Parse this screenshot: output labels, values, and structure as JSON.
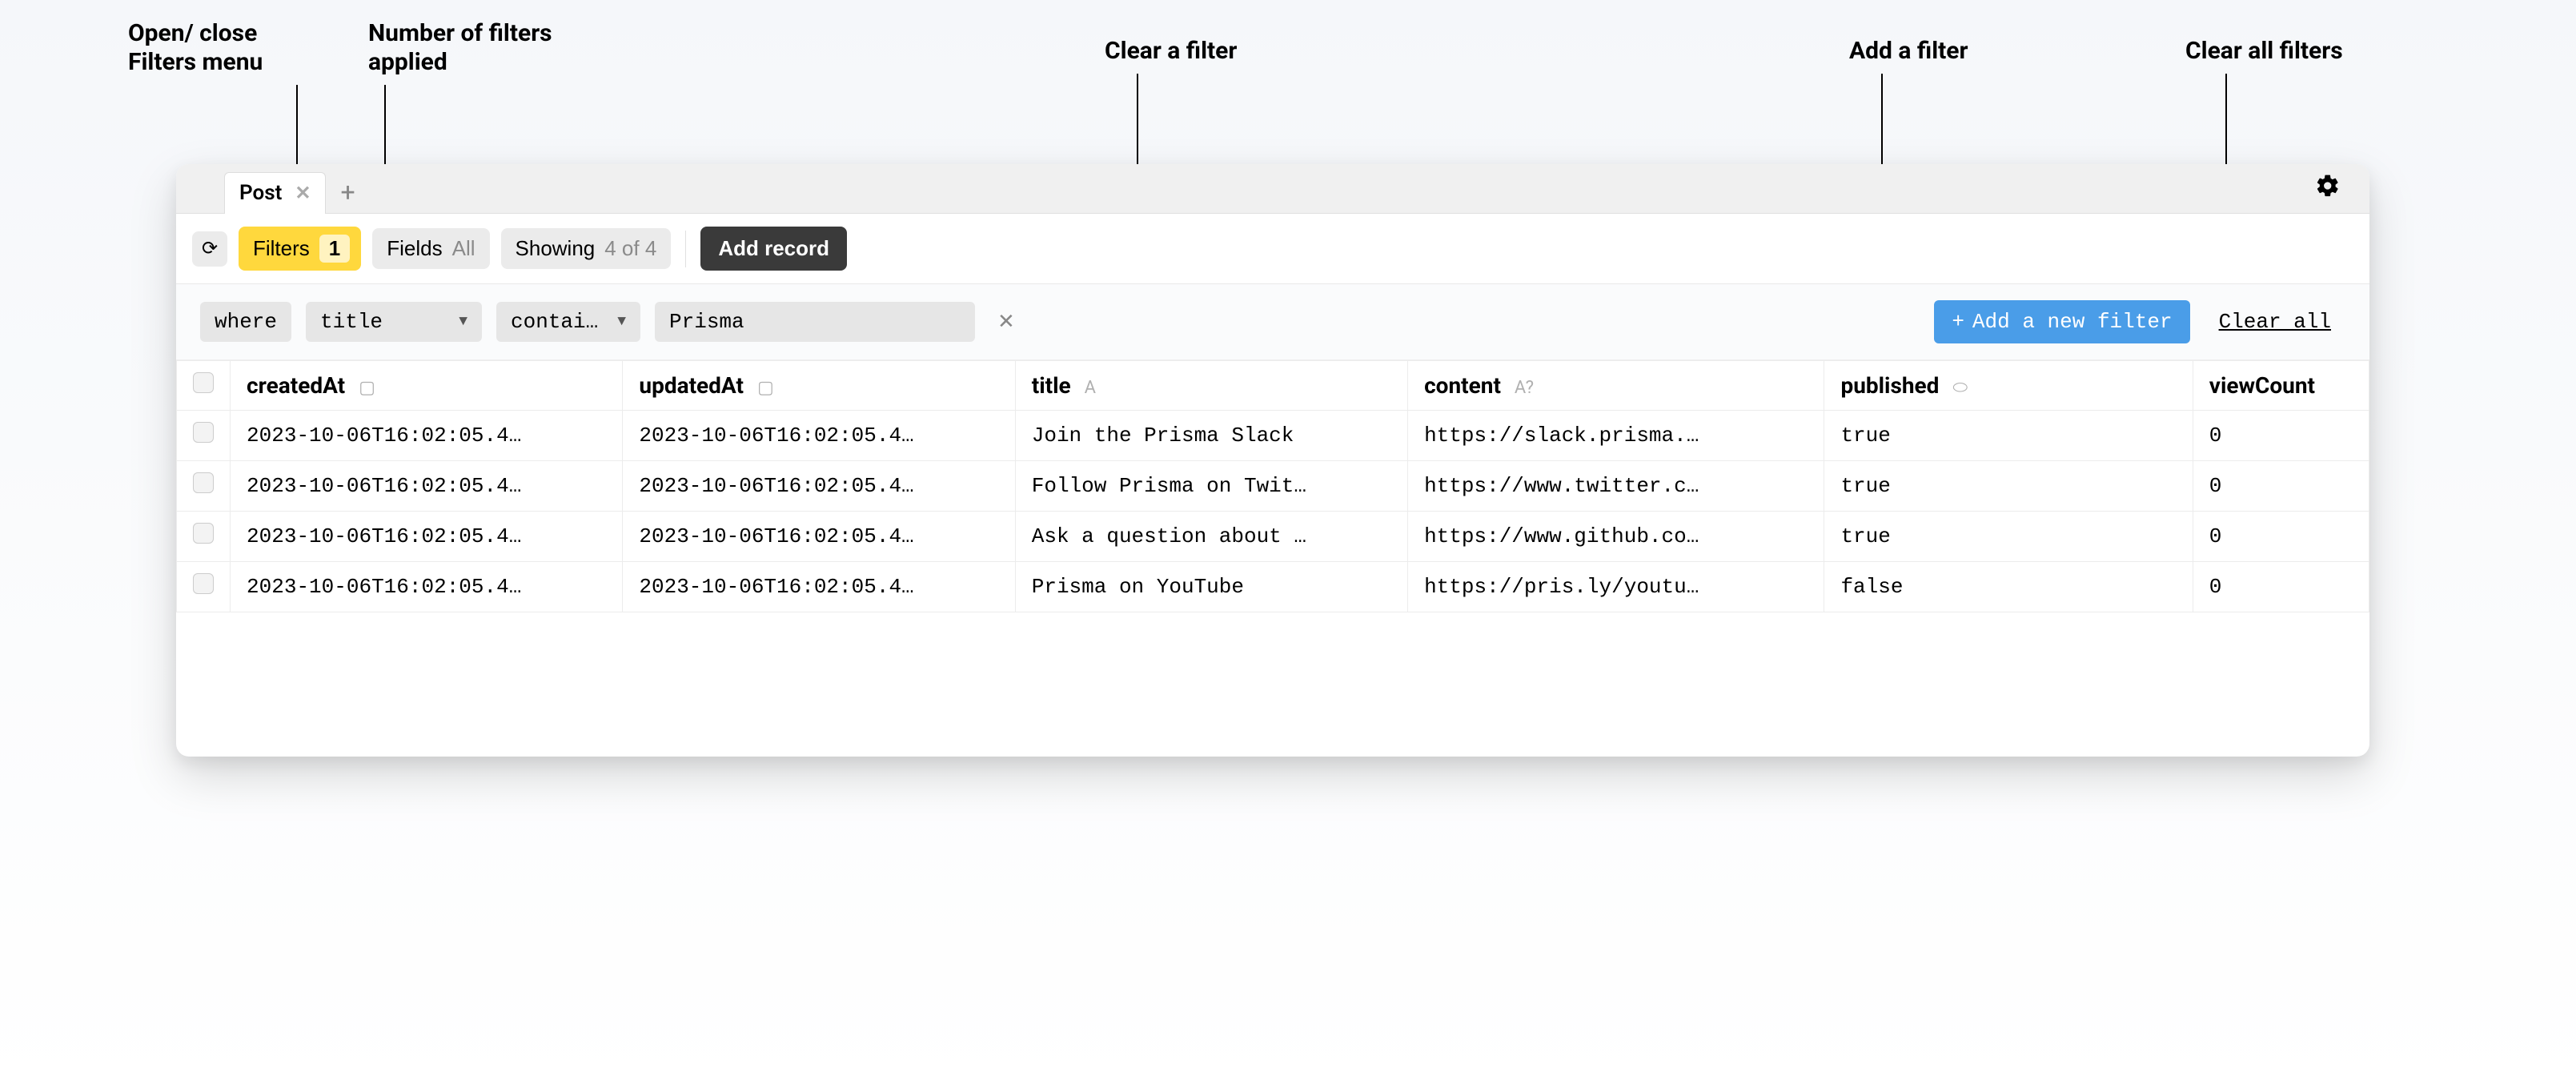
{
  "annotations": {
    "open_close": "Open/ close\nFilters menu",
    "num_applied": "Number of filters\napplied",
    "clear_one": "Clear a filter",
    "add_one": "Add a filter",
    "clear_all": "Clear all filters"
  },
  "tabs": {
    "active": "Post"
  },
  "toolbar": {
    "filters_label": "Filters",
    "filters_count": "1",
    "fields_label": "Fields",
    "fields_value": "All",
    "showing_label": "Showing",
    "showing_value": "4 of 4",
    "add_record": "Add record"
  },
  "filterbar": {
    "where": "where",
    "field": "title",
    "operator": "contai…",
    "value": "Prisma",
    "add_new": "Add a new filter",
    "clear_all": "Clear all"
  },
  "columns": {
    "createdAt": "createdAt",
    "updatedAt": "updatedAt",
    "title": "title",
    "content": "content",
    "published": "published",
    "viewCount": "viewCount"
  },
  "rows": [
    {
      "createdAt": "2023-10-06T16:02:05.4…",
      "updatedAt": "2023-10-06T16:02:05.4…",
      "title": "Join the Prisma Slack",
      "content": "https://slack.prisma.…",
      "published": "true",
      "viewCount": "0"
    },
    {
      "createdAt": "2023-10-06T16:02:05.4…",
      "updatedAt": "2023-10-06T16:02:05.4…",
      "title": "Follow Prisma on Twit…",
      "content": "https://www.twitter.c…",
      "published": "true",
      "viewCount": "0"
    },
    {
      "createdAt": "2023-10-06T16:02:05.4…",
      "updatedAt": "2023-10-06T16:02:05.4…",
      "title": "Ask a question about …",
      "content": "https://www.github.co…",
      "published": "true",
      "viewCount": "0"
    },
    {
      "createdAt": "2023-10-06T16:02:05.4…",
      "updatedAt": "2023-10-06T16:02:05.4…",
      "title": "Prisma on YouTube",
      "content": "https://pris.ly/youtu…",
      "published": "false",
      "viewCount": "0"
    }
  ]
}
